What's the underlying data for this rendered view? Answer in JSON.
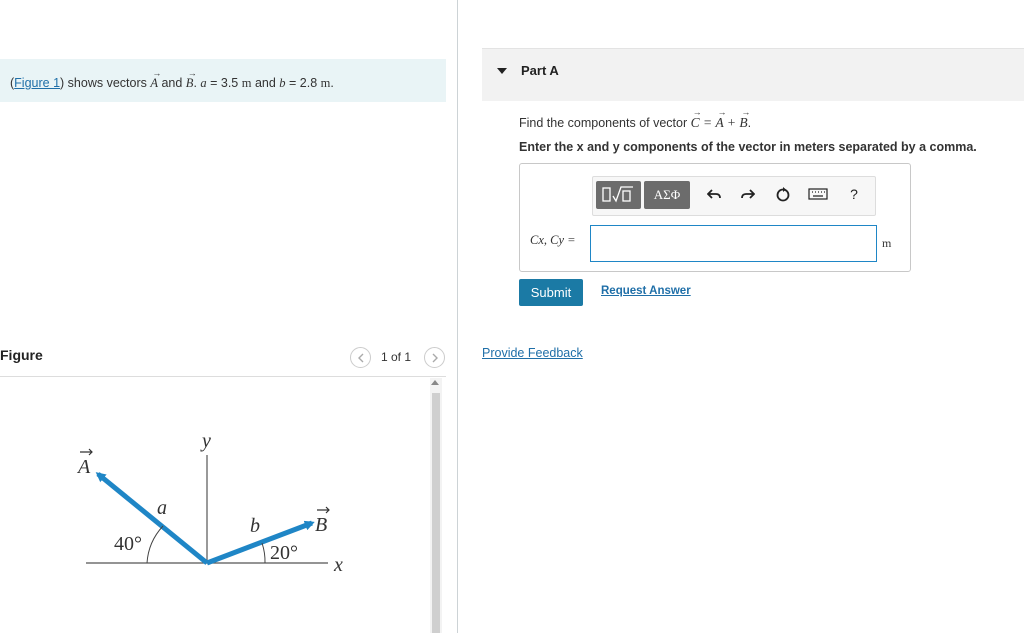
{
  "intro": {
    "figure_link": "Figure 1",
    "open_paren": "(",
    "text_a": ") shows vectors ",
    "vec_a": "A",
    "and_1": " and ",
    "vec_b": "B",
    "text_b": ". ",
    "a_var": "a",
    "a_val": " = 3.5 ",
    "unit_m": "m",
    "and_2": " and ",
    "b_var": "b",
    "b_val": " = 2.8 ",
    "unit_m2": "m",
    "period": "."
  },
  "part": {
    "title": "Part A",
    "question_prefix": "Find the components of vector ",
    "question_expr": "C = A + B",
    "question_period": ".",
    "instruction": "Enter the x and y components of the vector in meters separated by a comma.",
    "answer_label": "Cx, Cy =",
    "answer_value": "",
    "unit": "m",
    "submit_label": "Submit",
    "request_label": "Request Answer",
    "feedback_label": "Provide Feedback"
  },
  "toolbar": {
    "templates_icon": "sqrt-template-icon",
    "greek_label": "ΑΣΦ",
    "undo_icon": "undo-icon",
    "redo_icon": "redo-icon",
    "reset_icon": "reset-icon",
    "keyboard_icon": "keyboard-icon",
    "help_label": "?"
  },
  "figure": {
    "title": "Figure",
    "pager": "1 of 1",
    "labels": {
      "y": "y",
      "x": "x",
      "A": "A",
      "B": "B",
      "a": "a",
      "b": "b",
      "angle_a": "40°",
      "angle_b": "20°"
    }
  },
  "colors": {
    "vector_blue": "#1f86c6",
    "link_blue": "#1f6fa8",
    "submit_bg": "#1b7aa5",
    "banner_bg": "#e9f4f6"
  }
}
